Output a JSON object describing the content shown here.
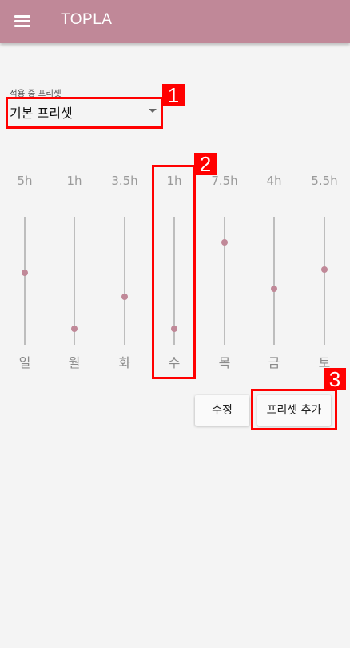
{
  "app": {
    "title": "TOPLA"
  },
  "preset": {
    "caption": "적용 중 프리셋",
    "selected": "기본 프리셋"
  },
  "schedule": {
    "days": [
      {
        "day": "일",
        "hours": "5h",
        "level": 0.5625
      },
      {
        "day": "월",
        "hours": "1h",
        "level": 0.125
      },
      {
        "day": "화",
        "hours": "3.5h",
        "level": 0.375
      },
      {
        "day": "수",
        "hours": "1h",
        "level": 0.125
      },
      {
        "day": "목",
        "hours": "7.5h",
        "level": 0.8
      },
      {
        "day": "금",
        "hours": "4h",
        "level": 0.4375
      },
      {
        "day": "토",
        "hours": "5.5h",
        "level": 0.585
      }
    ]
  },
  "actions": {
    "edit_label": "수정",
    "add_preset_label": "프리셋 추가"
  },
  "annotations": {
    "badge1": "1",
    "badge2": "2",
    "badge3": "3"
  },
  "colors": {
    "accent": "#c08898",
    "annotation": "#ff0000"
  }
}
